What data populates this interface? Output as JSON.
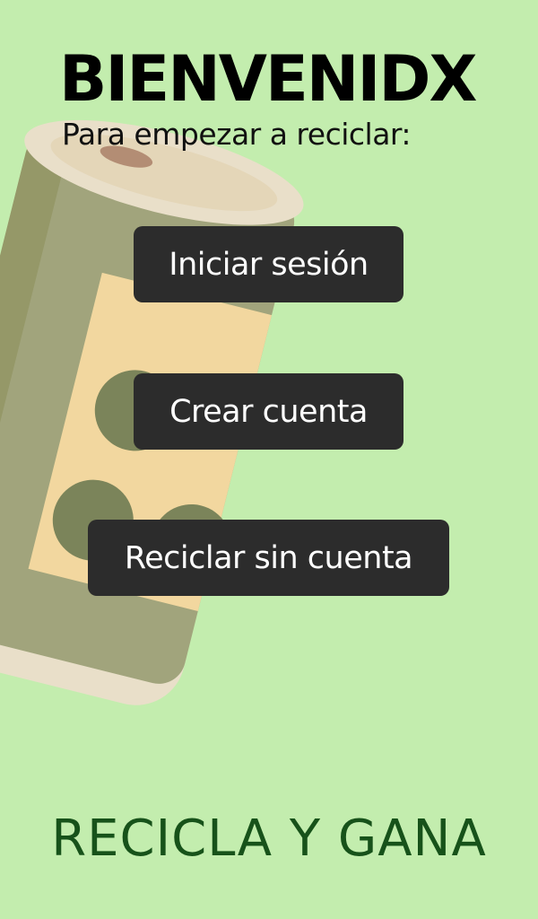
{
  "welcome": {
    "title": "BIENVENIDX",
    "subtitle": "Para empezar a reciclar:"
  },
  "actions": {
    "login_label": "Iniciar sesión",
    "create_account_label": "Crear cuenta",
    "guest_label": "Reciclar sin cuenta"
  },
  "footer": {
    "slogan": "RECICLA Y GANA"
  },
  "illustration": {
    "icon": "recycling-can-illustration"
  },
  "colors": {
    "background": "#c3edae",
    "button": "#2c2c2c",
    "button_text": "#ffffff",
    "slogan": "#17521a",
    "can_body": "#a1a47c",
    "can_label": "#f2d79f",
    "can_dots": "#7b845a",
    "can_rim": "#e9dfc9"
  }
}
